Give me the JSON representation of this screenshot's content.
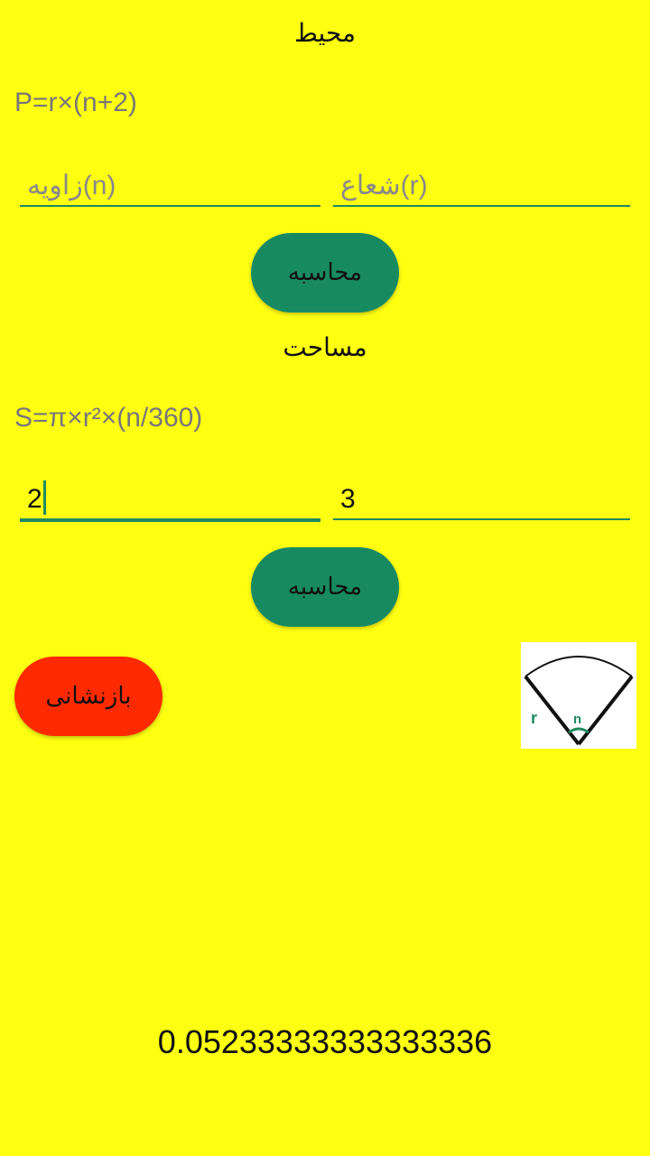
{
  "perimeter": {
    "title": "محیط",
    "formula": "P=r×(n+2)",
    "angle_field": {
      "placeholder": "زاویه(n)",
      "value": ""
    },
    "radius_field": {
      "placeholder": "شعاع(r)",
      "value": ""
    },
    "calc_label": "محاسبه"
  },
  "area": {
    "title": "مساحت",
    "formula": "S=π×r²×(n/360)",
    "angle_field": {
      "value": "2"
    },
    "radius_field": {
      "value": "3"
    },
    "calc_label": "محاسبه"
  },
  "reset_label": "بازنشانی",
  "diagram": {
    "icon": "circle-sector-diagram",
    "radius_label": "r",
    "angle_label": "n"
  },
  "result": "0.05233333333333336",
  "colors": {
    "background": "#ffff12",
    "accent": "#1e8a5d",
    "button_green": "#178a62",
    "button_red": "#ff2a00"
  }
}
